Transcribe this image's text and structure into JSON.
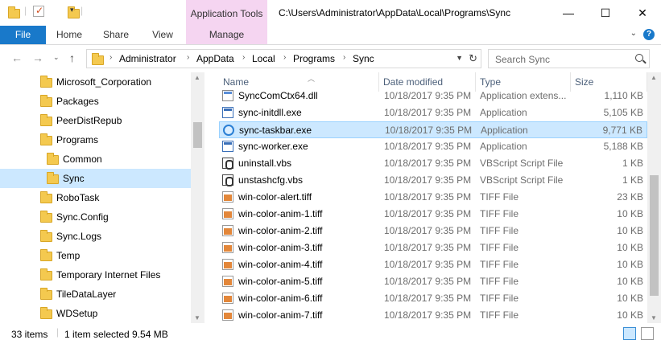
{
  "window": {
    "app_tools_label": "Application Tools",
    "title_path": "C:\\Users\\Administrator\\AppData\\Local\\Programs\\Sync",
    "minimize": "—",
    "maximize": "☐",
    "close": "✕"
  },
  "ribbon": {
    "tabs": [
      {
        "label": "File"
      },
      {
        "label": "Home"
      },
      {
        "label": "Share"
      },
      {
        "label": "View"
      },
      {
        "label": "Manage"
      }
    ],
    "help": "?"
  },
  "address": {
    "crumbs": [
      "Administrator",
      "AppData",
      "Local",
      "Programs",
      "Sync"
    ],
    "search_placeholder": "Search Sync"
  },
  "nav_tree": [
    {
      "label": "Microsoft_Corporation",
      "level": 0
    },
    {
      "label": "Packages",
      "level": 0
    },
    {
      "label": "PeerDistRepub",
      "level": 0
    },
    {
      "label": "Programs",
      "level": 0
    },
    {
      "label": "Common",
      "level": 1
    },
    {
      "label": "Sync",
      "level": 1,
      "selected": true
    },
    {
      "label": "RoboTask",
      "level": 0
    },
    {
      "label": "Sync.Config",
      "level": 0
    },
    {
      "label": "Sync.Logs",
      "level": 0
    },
    {
      "label": "Temp",
      "level": 0
    },
    {
      "label": "Temporary Internet Files",
      "level": 0
    },
    {
      "label": "TileDataLayer",
      "level": 0
    },
    {
      "label": "WDSetup",
      "level": 0
    }
  ],
  "columns": {
    "name": "Name",
    "date": "Date modified",
    "type": "Type",
    "size": "Size"
  },
  "files": [
    {
      "name": "SyncComCtx64.dll",
      "date": "10/18/2017 9:35 PM",
      "type": "Application extens...",
      "size": "1,110 KB",
      "icon": "dll"
    },
    {
      "name": "sync-initdll.exe",
      "date": "10/18/2017 9:35 PM",
      "type": "Application",
      "size": "5,105 KB",
      "icon": "exe"
    },
    {
      "name": "sync-taskbar.exe",
      "date": "10/18/2017 9:35 PM",
      "type": "Application",
      "size": "9,771 KB",
      "icon": "sync",
      "selected": true
    },
    {
      "name": "sync-worker.exe",
      "date": "10/18/2017 9:35 PM",
      "type": "Application",
      "size": "5,188 KB",
      "icon": "exe"
    },
    {
      "name": "uninstall.vbs",
      "date": "10/18/2017 9:35 PM",
      "type": "VBScript Script File",
      "size": "1 KB",
      "icon": "vbs"
    },
    {
      "name": "unstashcfg.vbs",
      "date": "10/18/2017 9:35 PM",
      "type": "VBScript Script File",
      "size": "1 KB",
      "icon": "vbs"
    },
    {
      "name": "win-color-alert.tiff",
      "date": "10/18/2017 9:35 PM",
      "type": "TIFF File",
      "size": "23 KB",
      "icon": "tiff"
    },
    {
      "name": "win-color-anim-1.tiff",
      "date": "10/18/2017 9:35 PM",
      "type": "TIFF File",
      "size": "10 KB",
      "icon": "tiff"
    },
    {
      "name": "win-color-anim-2.tiff",
      "date": "10/18/2017 9:35 PM",
      "type": "TIFF File",
      "size": "10 KB",
      "icon": "tiff"
    },
    {
      "name": "win-color-anim-3.tiff",
      "date": "10/18/2017 9:35 PM",
      "type": "TIFF File",
      "size": "10 KB",
      "icon": "tiff"
    },
    {
      "name": "win-color-anim-4.tiff",
      "date": "10/18/2017 9:35 PM",
      "type": "TIFF File",
      "size": "10 KB",
      "icon": "tiff"
    },
    {
      "name": "win-color-anim-5.tiff",
      "date": "10/18/2017 9:35 PM",
      "type": "TIFF File",
      "size": "10 KB",
      "icon": "tiff"
    },
    {
      "name": "win-color-anim-6.tiff",
      "date": "10/18/2017 9:35 PM",
      "type": "TIFF File",
      "size": "10 KB",
      "icon": "tiff"
    },
    {
      "name": "win-color-anim-7.tiff",
      "date": "10/18/2017 9:35 PM",
      "type": "TIFF File",
      "size": "10 KB",
      "icon": "tiff"
    }
  ],
  "status": {
    "items_count": "33 items",
    "selection": "1 item selected  9.54 MB"
  },
  "colors": {
    "accent": "#1979ca",
    "manage_tab": "#f5d5f1",
    "selection": "#cce8ff",
    "folder": "#f4c94f"
  }
}
